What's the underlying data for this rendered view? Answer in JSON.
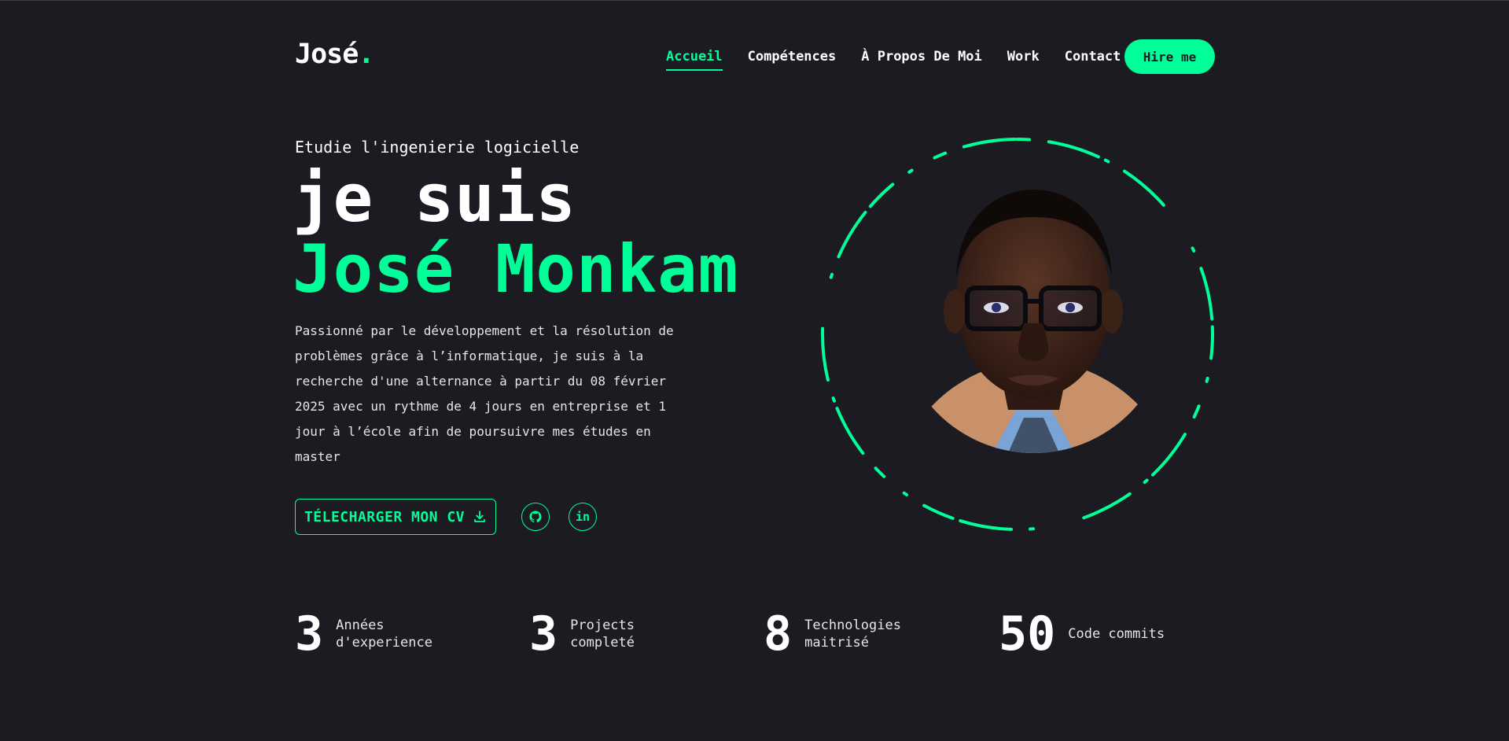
{
  "header": {
    "logo_text": "José",
    "logo_dot": ".",
    "nav": [
      {
        "label": "Accueil",
        "active": true
      },
      {
        "label": "Compétences"
      },
      {
        "label": "À Propos De Moi"
      },
      {
        "label": "Work"
      },
      {
        "label": "Contact"
      }
    ],
    "hire_label": "Hire me"
  },
  "hero": {
    "subtitle": "Etudie l'ingenierie logicielle",
    "headline_line1": "je suis",
    "headline_line2": "José Monkam",
    "description": "Passionné par le développement et la résolution de problèmes grâce à l’informatique, je suis à la recherche d'une alternance à partir du 08 février 2025 avec un rythme de 4 jours en entreprise et 1 jour à l’école afin de poursuivre mes études en master",
    "cv_label": "TÉLECHARGER MON CV",
    "social": [
      {
        "icon": "github-icon"
      },
      {
        "icon": "linkedin-icon",
        "text": "in"
      }
    ]
  },
  "stats": [
    {
      "value": "3",
      "label": "Années d'experience"
    },
    {
      "value": "3",
      "label": "Projects completé"
    },
    {
      "value": "8",
      "label": "Technologies maitrisé"
    },
    {
      "value": "50",
      "label": "Code commits"
    }
  ],
  "colors": {
    "accent": "#00ff99",
    "background": "#1c1b22"
  }
}
